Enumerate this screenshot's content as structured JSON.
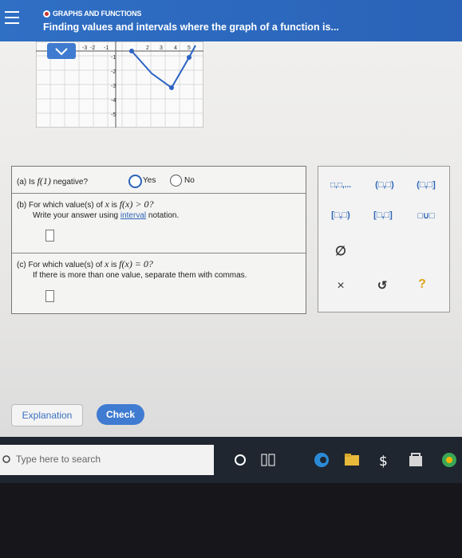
{
  "header": {
    "topic": "GRAPHS AND FUNCTIONS",
    "title": "Finding values and intervals where the graph of a function is..."
  },
  "graph": {
    "x_ticks": [
      "-3",
      "-2",
      "-1",
      "2",
      "3",
      "4",
      "5"
    ],
    "y_ticks": [
      "-1",
      "-2",
      "-3",
      "-4",
      "-5"
    ]
  },
  "questions": {
    "a": {
      "prefix": "(a)  Is",
      "expr": "f(1)",
      "suffix": "negative?",
      "yes": "Yes",
      "no": "No"
    },
    "b": {
      "prefix": "(b)  For which value(s) of",
      "var": "x",
      "is": "is",
      "expr": "f(x) > 0?",
      "hint": "Write your answer using",
      "link": "interval",
      "hint_end": "notation."
    },
    "c": {
      "prefix": "(c)  For which value(s) of",
      "var": "x",
      "is": "is",
      "expr": "f(x) = 0?",
      "hint": "If there is more than one value, separate them with commas."
    }
  },
  "palette": {
    "row1": [
      "□,□,...",
      "(□,□)",
      "(□,□]"
    ],
    "row2": [
      "[□,□)",
      "[□,□]",
      "□∪□"
    ],
    "empty": "∅",
    "clear": "×",
    "undo": "↺",
    "help": "?"
  },
  "buttons": {
    "explanation": "Explanation",
    "check": "Check"
  },
  "taskbar": {
    "search_placeholder": "Type here to search"
  }
}
